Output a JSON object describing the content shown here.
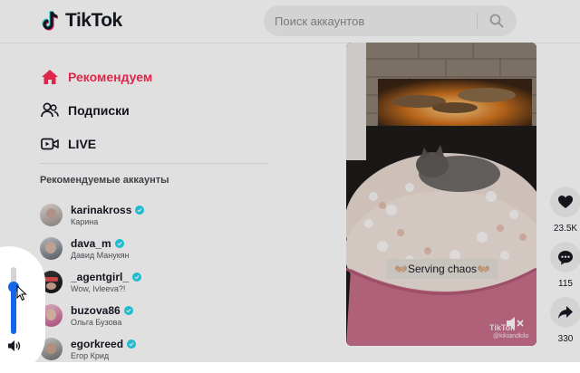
{
  "header": {
    "brand": "TikTok",
    "search_placeholder": "Поиск аккаунтов"
  },
  "nav": [
    {
      "label": "Рекомендуем",
      "icon": "home-icon",
      "active": true
    },
    {
      "label": "Подписки",
      "icon": "people-icon",
      "active": false
    },
    {
      "label": "LIVE",
      "icon": "live-icon",
      "active": false
    }
  ],
  "suggested_title": "Рекомендуемые аккаунты",
  "accounts": [
    {
      "username": "karinakross",
      "name": "Карина",
      "verified": true
    },
    {
      "username": "dava_m",
      "name": "Давид Манукян",
      "verified": true
    },
    {
      "username": "_agentgirl_",
      "name": "Wow, Ivleeva?!",
      "verified": true
    },
    {
      "username": "buzova86",
      "name": "Ольга Бузова",
      "verified": true
    },
    {
      "username": "egorkreed",
      "name": "Егор Крид",
      "verified": true
    }
  ],
  "video": {
    "caption": "👐🏼Serving chaos👐🏼",
    "watermark_logo": "TikTok",
    "watermark_user": "@kikiandkilo"
  },
  "actions": [
    {
      "icon": "heart-icon",
      "count": "23.5K"
    },
    {
      "icon": "comment-icon",
      "count": "115"
    },
    {
      "icon": "share-icon",
      "count": "330"
    }
  ],
  "volume": {
    "level": 0.7
  },
  "colors": {
    "accent": "#fe2c55",
    "verified": "#20d5ec",
    "volume": "#1366e8"
  }
}
